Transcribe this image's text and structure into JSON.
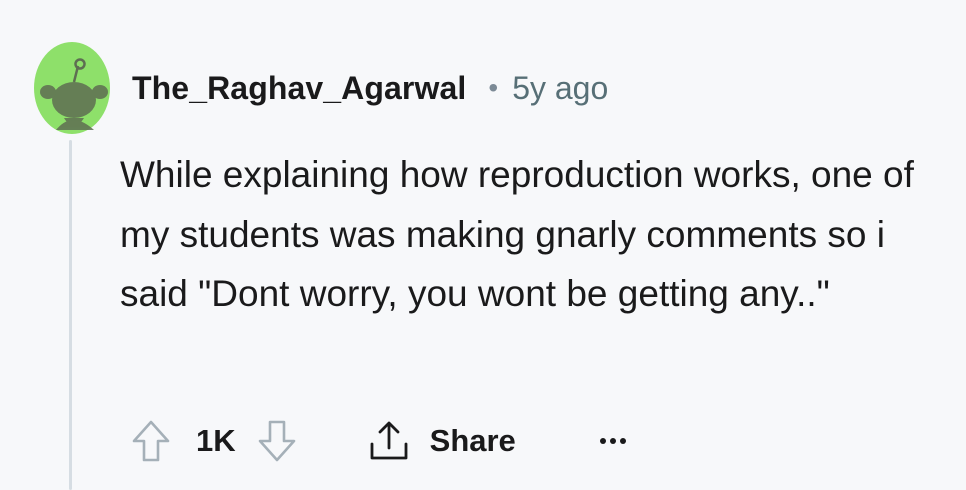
{
  "comment": {
    "author": "The_Raghav_Agarwal",
    "separator": "•",
    "age": "5y ago",
    "body": "While explaining how reproduction works, one of my students was making gnarly comments so i said \"Dont worry, you wont be getting any..\"",
    "score": "1K",
    "share_label": "Share"
  },
  "icons": {
    "avatar": "snoo-avatar-icon",
    "upvote": "upvote-arrow-icon",
    "downvote": "downvote-arrow-icon",
    "share": "share-icon",
    "more": "more-options-icon"
  },
  "colors": {
    "background": "#f7f8fa",
    "avatar_green": "#8ee06a",
    "text": "#1a1a1b",
    "muted": "#576f76",
    "thread_line": "#d6dde3"
  }
}
